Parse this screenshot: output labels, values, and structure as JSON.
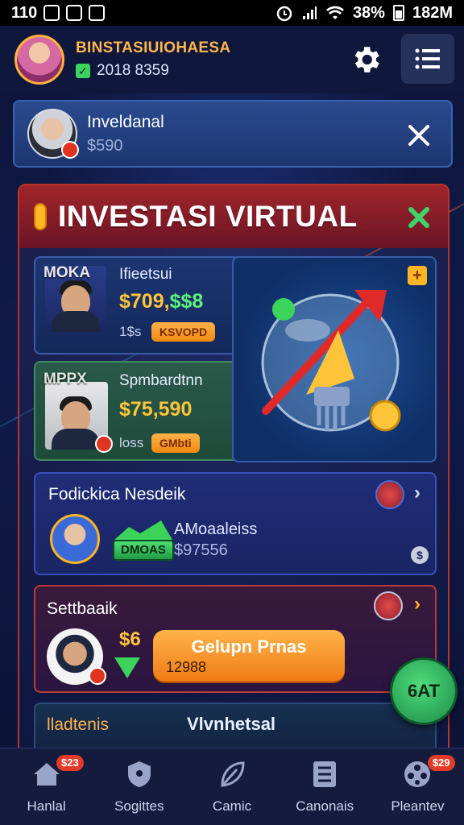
{
  "status_bar": {
    "left_text": "110",
    "battery": "38%",
    "right_text": "182M"
  },
  "header": {
    "title": "BINSTASIUIOHAESA",
    "subtitle": "2018 8359"
  },
  "notification": {
    "name": "Inveldanal",
    "value": "$590"
  },
  "banner": {
    "title": "INVESTASI VIRTUAL"
  },
  "card1": {
    "photo_tag": "MOKA",
    "title": "Ifieetsui",
    "value": "$709,",
    "value_green": "$$8",
    "small": "1$s",
    "pill": "KSVOPD"
  },
  "card2": {
    "photo_tag": "MPPX",
    "title": "Spmbardtnn",
    "value": "$75,590",
    "small": "loss",
    "pill": "GMbti"
  },
  "card3": {
    "title": "Fodickica Nesdeik",
    "badge": "DMOAS",
    "label": "AMoaaleiss",
    "number": "$97556"
  },
  "card4": {
    "title": "Settbaaik",
    "amount": "$6",
    "button_label": "Gelupn Prnas",
    "button_sub": "12988"
  },
  "card5": {
    "left": "lladtenis",
    "right": "Vlvnhetsal"
  },
  "fab": {
    "label": "6AT"
  },
  "nav": {
    "items": [
      {
        "label": "Hanlal",
        "badge": "$23"
      },
      {
        "label": "Sogittes",
        "badge": ""
      },
      {
        "label": "Camic",
        "badge": ""
      },
      {
        "label": "Canonais",
        "badge": ""
      },
      {
        "label": "Pleantev",
        "badge": "$29"
      }
    ]
  },
  "colors": {
    "accent": "#ffb524",
    "danger": "#b8332c",
    "success": "#3bd35a"
  }
}
